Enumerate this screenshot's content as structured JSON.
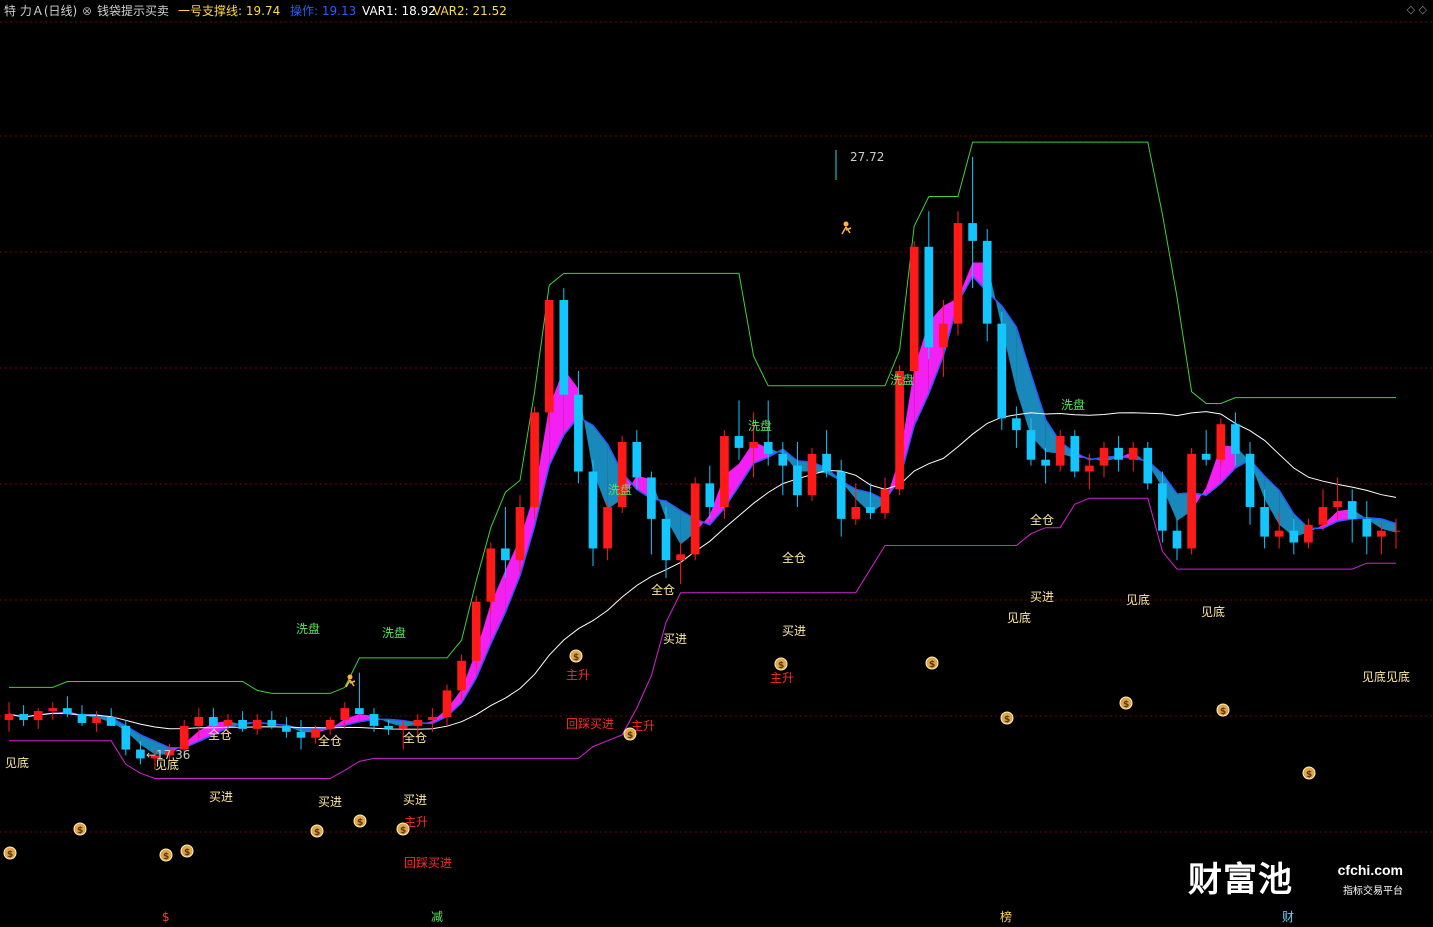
{
  "header": {
    "stock": "特 力Ａ(日线)",
    "indicator": "钱袋提示买卖",
    "support": "一号支撑线: 19.74",
    "operate": "操作: 19.13",
    "var1": "VAR1: 18.92",
    "var2": "VAR2: 21.52",
    "corner": "◇ ◇"
  },
  "colors": {
    "up": "#ff1a1a",
    "down": "#14c6ff",
    "ma": "#ffffff",
    "band": "#ff22ff",
    "band2": "#1a8fc4",
    "support": "#3bd23b",
    "low": "#d323d3"
  },
  "watermark": {
    "brand": "财富池",
    "url": "cfchi.com",
    "sub": "指标交易平台"
  },
  "price_labels": {
    "high": "27.72",
    "low": "←17.36"
  },
  "bottom_labels": [
    "$",
    "减",
    "榜",
    "财"
  ],
  "chart_data": {
    "type": "candlestick",
    "title": "钱袋提示买卖",
    "ylim": [
      14.7,
      30.0
    ],
    "x_count": 100,
    "candles": [
      [
        18.2,
        18.5,
        18.0,
        18.3
      ],
      [
        18.3,
        18.45,
        18.1,
        18.2
      ],
      [
        18.2,
        18.4,
        18.05,
        18.35
      ],
      [
        18.35,
        18.5,
        18.2,
        18.4
      ],
      [
        18.4,
        18.6,
        18.25,
        18.3
      ],
      [
        18.3,
        18.45,
        18.1,
        18.15
      ],
      [
        18.15,
        18.35,
        18.0,
        18.25
      ],
      [
        18.25,
        18.4,
        18.1,
        18.1
      ],
      [
        18.1,
        18.2,
        17.6,
        17.7
      ],
      [
        17.7,
        17.85,
        17.45,
        17.55
      ],
      [
        17.55,
        17.7,
        17.36,
        17.6
      ],
      [
        17.6,
        17.8,
        17.5,
        17.7
      ],
      [
        17.7,
        18.2,
        17.65,
        18.1
      ],
      [
        18.1,
        18.4,
        17.9,
        18.25
      ],
      [
        18.25,
        18.4,
        18.05,
        18.1
      ],
      [
        18.1,
        18.3,
        17.95,
        18.2
      ],
      [
        18.2,
        18.35,
        18.0,
        18.05
      ],
      [
        18.05,
        18.3,
        17.95,
        18.2
      ],
      [
        18.2,
        18.35,
        18.05,
        18.1
      ],
      [
        18.1,
        18.25,
        17.9,
        18.0
      ],
      [
        18.0,
        18.2,
        17.7,
        17.9
      ],
      [
        17.9,
        18.1,
        17.8,
        18.05
      ],
      [
        18.05,
        18.25,
        17.95,
        18.2
      ],
      [
        18.2,
        18.5,
        18.05,
        18.4
      ],
      [
        18.4,
        19.0,
        18.3,
        18.3
      ],
      [
        18.3,
        18.4,
        18.0,
        18.1
      ],
      [
        18.1,
        18.2,
        17.95,
        18.05
      ],
      [
        18.05,
        18.2,
        17.7,
        18.1
      ],
      [
        18.1,
        18.3,
        17.9,
        18.2
      ],
      [
        18.2,
        18.4,
        18.0,
        18.25
      ],
      [
        18.25,
        18.8,
        18.1,
        18.7
      ],
      [
        18.7,
        19.3,
        18.55,
        19.2
      ],
      [
        19.2,
        20.3,
        19.1,
        20.2
      ],
      [
        20.2,
        21.2,
        20.0,
        21.1
      ],
      [
        21.1,
        21.8,
        20.6,
        20.9
      ],
      [
        20.9,
        22.0,
        20.7,
        21.8
      ],
      [
        21.8,
        23.5,
        21.6,
        23.4
      ],
      [
        23.4,
        25.3,
        23.2,
        25.3
      ],
      [
        25.3,
        25.5,
        23.7,
        23.7
      ],
      [
        23.7,
        24.1,
        22.2,
        22.4
      ],
      [
        22.4,
        22.6,
        20.8,
        21.1
      ],
      [
        21.1,
        21.9,
        20.9,
        21.8
      ],
      [
        21.8,
        23.0,
        21.7,
        22.9
      ],
      [
        22.9,
        23.1,
        22.1,
        22.3
      ],
      [
        22.3,
        22.4,
        21.0,
        21.6
      ],
      [
        21.6,
        21.8,
        20.6,
        20.9
      ],
      [
        20.9,
        21.2,
        20.5,
        21.0
      ],
      [
        21.0,
        22.3,
        20.9,
        22.2
      ],
      [
        22.2,
        22.5,
        21.6,
        21.8
      ],
      [
        21.8,
        23.1,
        21.6,
        23.0
      ],
      [
        23.0,
        23.6,
        22.6,
        22.8
      ],
      [
        22.8,
        23.4,
        22.3,
        22.9
      ],
      [
        22.9,
        23.6,
        22.5,
        22.7
      ],
      [
        22.7,
        22.9,
        22.0,
        22.5
      ],
      [
        22.5,
        22.9,
        21.8,
        22.0
      ],
      [
        22.0,
        22.8,
        21.9,
        22.7
      ],
      [
        22.7,
        23.1,
        22.3,
        22.4
      ],
      [
        22.4,
        22.6,
        21.3,
        21.6
      ],
      [
        21.6,
        22.2,
        21.5,
        21.8
      ],
      [
        21.8,
        22.2,
        21.6,
        21.7
      ],
      [
        21.7,
        22.3,
        21.6,
        22.1
      ],
      [
        22.1,
        24.2,
        22.0,
        24.1
      ],
      [
        24.1,
        26.3,
        23.9,
        26.2
      ],
      [
        26.2,
        26.8,
        24.3,
        24.5
      ],
      [
        24.5,
        25.3,
        24.0,
        24.9
      ],
      [
        24.9,
        26.8,
        24.7,
        26.6
      ],
      [
        26.6,
        27.72,
        25.5,
        26.3
      ],
      [
        26.3,
        26.5,
        24.6,
        24.9
      ],
      [
        24.9,
        25.1,
        23.1,
        23.3
      ],
      [
        23.3,
        23.5,
        22.8,
        23.1
      ],
      [
        23.1,
        23.3,
        22.5,
        22.6
      ],
      [
        22.6,
        22.8,
        22.2,
        22.5
      ],
      [
        22.5,
        23.1,
        22.4,
        23.0
      ],
      [
        23.0,
        23.1,
        22.3,
        22.4
      ],
      [
        22.4,
        22.7,
        22.1,
        22.5
      ],
      [
        22.5,
        22.9,
        22.3,
        22.8
      ],
      [
        22.8,
        23.0,
        22.4,
        22.6
      ],
      [
        22.6,
        22.9,
        22.4,
        22.8
      ],
      [
        22.8,
        22.9,
        22.1,
        22.2
      ],
      [
        22.2,
        22.4,
        21.2,
        21.4
      ],
      [
        21.4,
        21.6,
        20.9,
        21.1
      ],
      [
        21.1,
        22.8,
        21.0,
        22.7
      ],
      [
        22.7,
        23.1,
        22.5,
        22.6
      ],
      [
        22.6,
        23.3,
        22.5,
        23.2
      ],
      [
        23.2,
        23.4,
        22.5,
        22.7
      ],
      [
        22.7,
        22.9,
        21.5,
        21.8
      ],
      [
        21.8,
        22.1,
        21.1,
        21.3
      ],
      [
        21.3,
        21.7,
        21.1,
        21.4
      ],
      [
        21.4,
        21.6,
        21.0,
        21.2
      ],
      [
        21.2,
        21.6,
        21.1,
        21.5
      ],
      [
        21.5,
        22.1,
        21.4,
        21.8
      ],
      [
        21.8,
        22.3,
        21.6,
        21.9
      ],
      [
        21.9,
        22.1,
        21.2,
        21.6
      ],
      [
        21.6,
        21.9,
        21.0,
        21.3
      ],
      [
        21.3,
        21.5,
        21.0,
        21.4
      ],
      [
        21.4,
        21.6,
        21.1,
        21.4
      ]
    ]
  }
}
